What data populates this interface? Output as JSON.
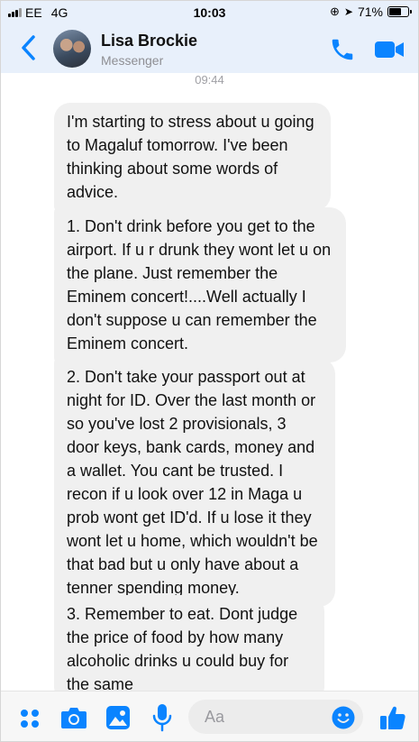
{
  "status_bar": {
    "carrier": "EE",
    "network": "4G",
    "time": "10:03",
    "battery_percent": "71%",
    "battery_level": 0.71
  },
  "header": {
    "name": "Lisa Brockie",
    "subtitle": "Messenger",
    "accent_color": "#0a84ff"
  },
  "conversation": {
    "timestamp": "09:44",
    "messages": [
      {
        "text": "I'm starting to stress about u going to Magaluf tomorrow. I've been thinking about some words of advice."
      },
      {
        "text": "1. Don't drink before you get to the airport. If u r drunk they wont let u on the plane. Just remember the Eminem concert!....Well actually I don't suppose u can remember the Eminem concert."
      },
      {
        "text": "2. Don't take your passport out at night for ID. Over the last month or so you've lost 2 provisionals, 3 door keys, bank cards, money and a wallet. You cant be trusted. I recon if u look over 12 in Maga u prob wont get ID'd. If u lose it they wont let u home, which wouldn't be that bad but u only have about a tenner spending money."
      },
      {
        "text": "3. Remember to eat. Dont judge the price of food by how many alcoholic drinks u could buy for the same"
      }
    ]
  },
  "composer": {
    "placeholder": "Aa",
    "icons": [
      "apps-icon",
      "camera-icon",
      "photo-icon",
      "microphone-icon",
      "emoji-icon",
      "thumbs-up-icon"
    ]
  }
}
